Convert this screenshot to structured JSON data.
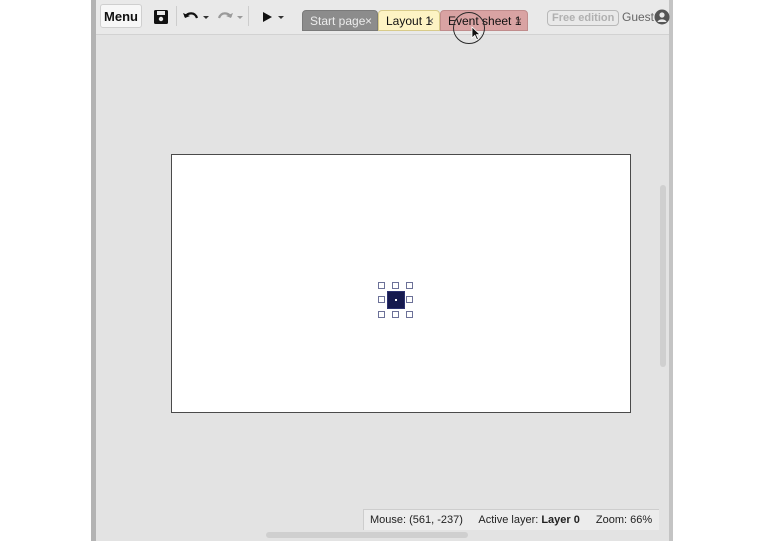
{
  "toolbar": {
    "menu_label": "Menu",
    "icons": [
      "save-icon",
      "undo-icon",
      "redo-icon",
      "play-icon",
      "chevron-down-icon"
    ]
  },
  "tabs": [
    {
      "label": "Start page",
      "close": "×"
    },
    {
      "label": "Layout 1",
      "close": "×"
    },
    {
      "label": "Event sheet 1",
      "close": "×"
    }
  ],
  "edition_badge": "Free edition",
  "user": {
    "label": "Guest",
    "icon": "user-circle-icon"
  },
  "status": {
    "mouse": "Mouse: (561, -237)",
    "active_layer_prefix": "Active layer:",
    "active_layer_value": "Layer 0",
    "zoom": "Zoom: 66%"
  },
  "colors": {
    "workspace": "#e3e3e3",
    "layout_tab": "#fdf3c4",
    "event_tab": "#d9a3a3",
    "start_tab": "#8c8c8c",
    "sprite": "#161a4f"
  }
}
